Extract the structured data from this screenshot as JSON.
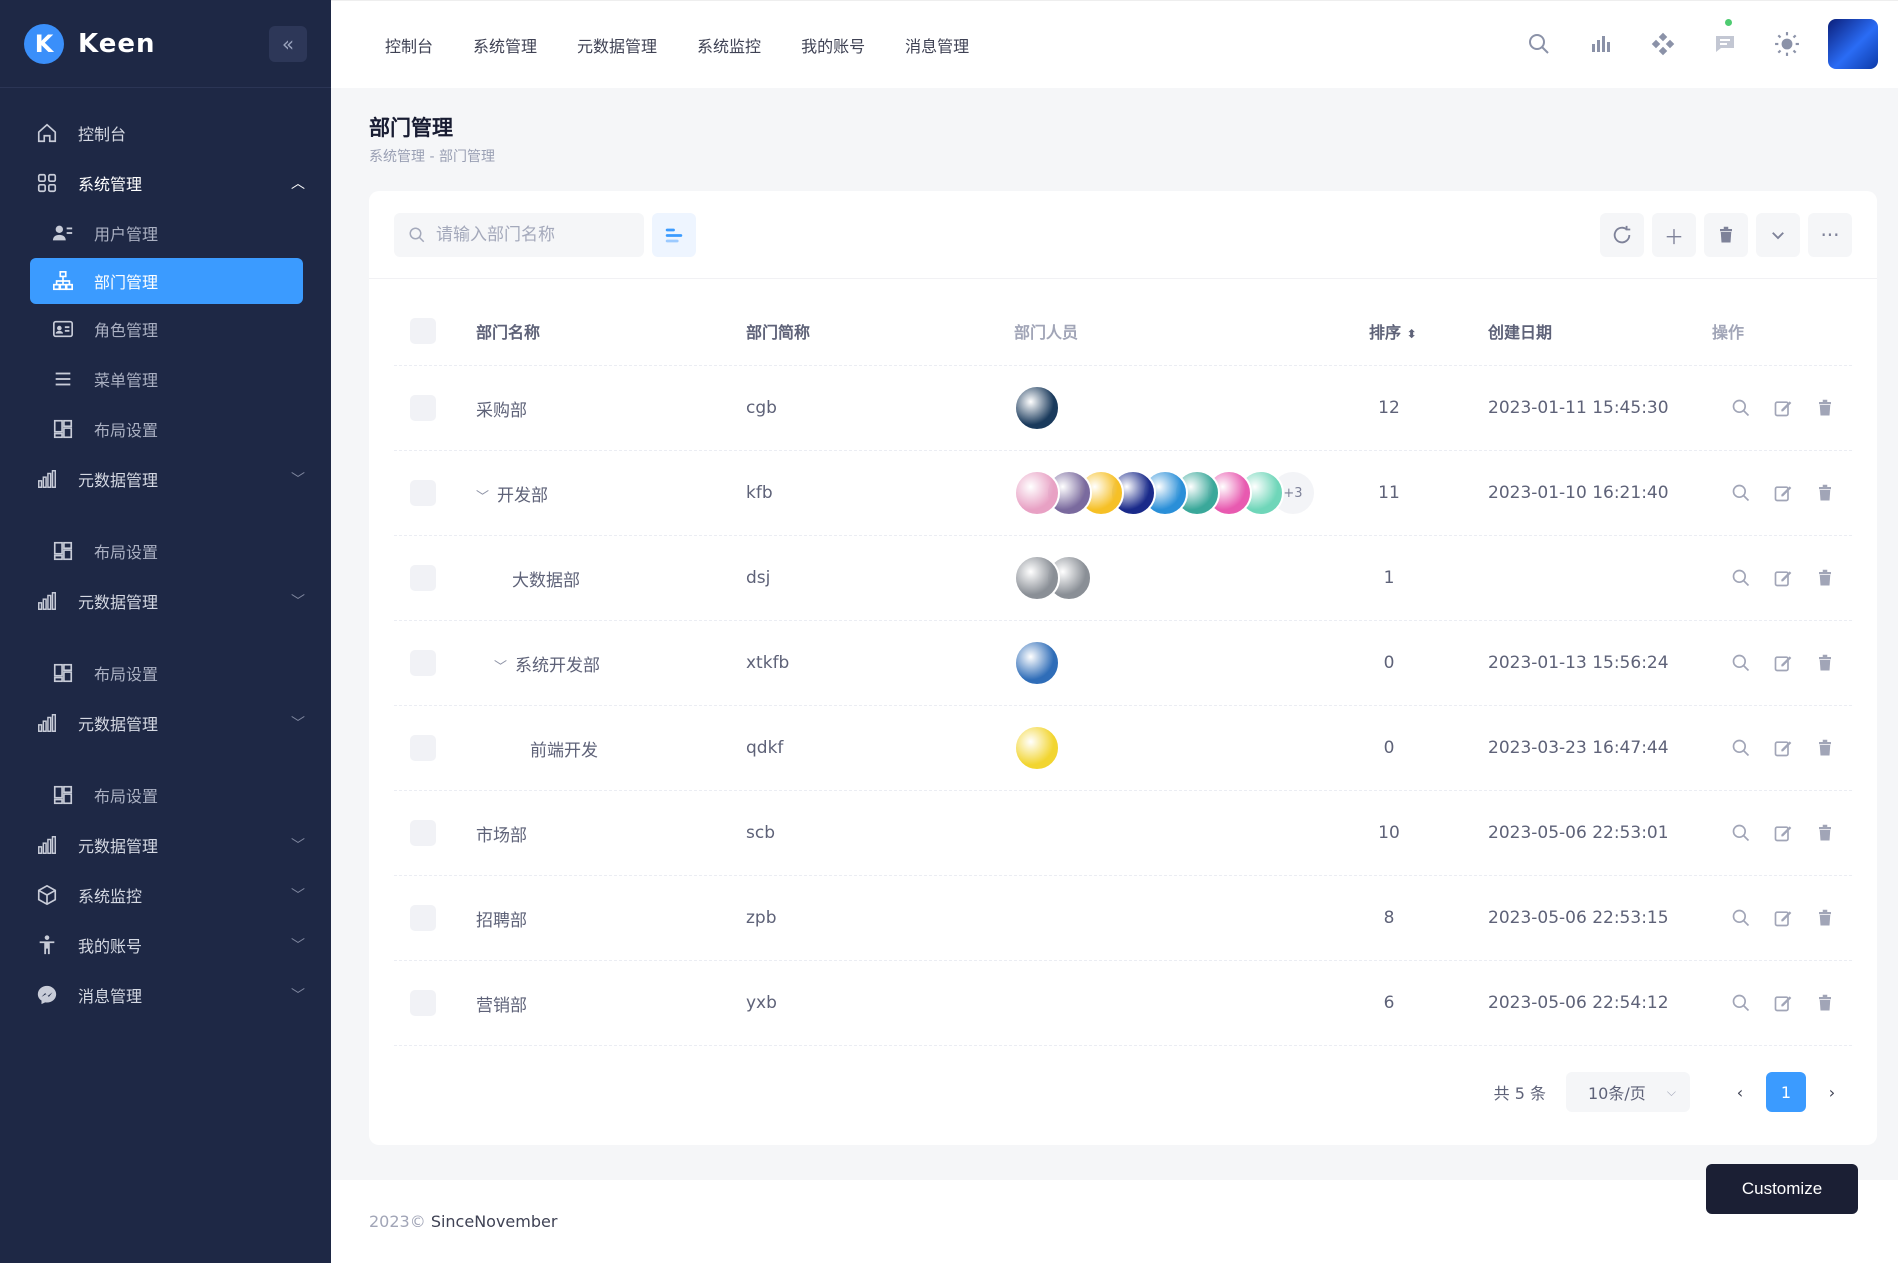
{
  "brand": {
    "logo_letter": "K",
    "name": "Keen"
  },
  "sidebar": {
    "items": [
      {
        "label": "控制台",
        "icon": "home-icon",
        "type": "top"
      },
      {
        "label": "系统管理",
        "icon": "grid-icon",
        "type": "parent-open"
      },
      {
        "label": "用户管理",
        "icon": "user-list-icon",
        "type": "sub"
      },
      {
        "label": "部门管理",
        "icon": "org-tree-icon",
        "type": "selected"
      },
      {
        "label": "角色管理",
        "icon": "id-card-icon",
        "type": "sub"
      },
      {
        "label": "菜单管理",
        "icon": "menu-lines-icon",
        "type": "sub"
      },
      {
        "label": "布局设置",
        "icon": "layout-icon",
        "type": "sub"
      },
      {
        "label": "元数据管理",
        "icon": "bar-chart-icon",
        "type": "parent"
      },
      {
        "label": "布局设置",
        "icon": "layout-icon",
        "type": "sub"
      },
      {
        "label": "元数据管理",
        "icon": "bar-chart-icon",
        "type": "parent"
      },
      {
        "label": "布局设置",
        "icon": "layout-icon",
        "type": "sub"
      },
      {
        "label": "元数据管理",
        "icon": "bar-chart-icon",
        "type": "parent"
      },
      {
        "label": "布局设置",
        "icon": "layout-icon",
        "type": "sub"
      },
      {
        "label": "元数据管理",
        "icon": "bar-chart-icon",
        "type": "parent"
      },
      {
        "label": "系统监控",
        "icon": "cube-icon",
        "type": "parent"
      },
      {
        "label": "我的账号",
        "icon": "person-icon",
        "type": "parent"
      },
      {
        "label": "消息管理",
        "icon": "messenger-icon",
        "type": "parent"
      }
    ]
  },
  "top_nav": [
    "控制台",
    "系统管理",
    "元数据管理",
    "系统监控",
    "我的账号",
    "消息管理"
  ],
  "page": {
    "title": "部门管理",
    "breadcrumb": "系统管理 - 部门管理"
  },
  "search": {
    "placeholder": "请输入部门名称",
    "value": ""
  },
  "table": {
    "headers": {
      "name": "部门名称",
      "short": "部门简称",
      "members": "部门人员",
      "sort": "排序",
      "date": "创建日期",
      "ops": "操作"
    },
    "rows": [
      {
        "name": "采购部",
        "level": 0,
        "expanded": false,
        "short": "cgb",
        "members": [
          "#1a3a5c"
        ],
        "more": "",
        "sort": "12",
        "date": "2023-01-11 15:45:30"
      },
      {
        "name": "开发部",
        "level": 0,
        "expanded": true,
        "short": "kfb",
        "members": [
          "#e8a1c4",
          "#7a6a9e",
          "#f6c026",
          "#1a2a8a",
          "#2a8fd8",
          "#3aa89a",
          "#e85ab0",
          "#6fd6b9"
        ],
        "more": "+3",
        "sort": "11",
        "date": "2023-01-10 16:21:40"
      },
      {
        "name": "大数据部",
        "level": 1,
        "expanded": false,
        "short": "dsj",
        "members": [
          "#8a8f96",
          "#8a8f96"
        ],
        "more": "",
        "sort": "1",
        "date": ""
      },
      {
        "name": "系统开发部",
        "level": 1,
        "expanded": true,
        "short": "xtkfb",
        "members": [
          "#2f6db8"
        ],
        "more": "",
        "sort": "0",
        "date": "2023-01-13 15:56:24"
      },
      {
        "name": "前端开发",
        "level": 2,
        "expanded": false,
        "short": "qdkf",
        "members": [
          "#f2d530"
        ],
        "more": "",
        "sort": "0",
        "date": "2023-03-23 16:47:44"
      },
      {
        "name": "市场部",
        "level": 0,
        "expanded": false,
        "short": "scb",
        "members": [],
        "more": "",
        "sort": "10",
        "date": "2023-05-06 22:53:01"
      },
      {
        "name": "招聘部",
        "level": 0,
        "expanded": false,
        "short": "zpb",
        "members": [],
        "more": "",
        "sort": "8",
        "date": "2023-05-06 22:53:15"
      },
      {
        "name": "营销部",
        "level": 0,
        "expanded": false,
        "short": "yxb",
        "members": [],
        "more": "",
        "sort": "6",
        "date": "2023-05-06 22:54:12"
      }
    ]
  },
  "pagination": {
    "total": "共 5 条",
    "page_size": "10条/页",
    "current": "1"
  },
  "footer": {
    "year": "2023©",
    "brand": "SinceNovember"
  },
  "customize_label": "Customize",
  "colors": {
    "sidebar_bg": "#1e2845",
    "accent": "#3b9bff",
    "online_dot": "#4ecb71"
  }
}
